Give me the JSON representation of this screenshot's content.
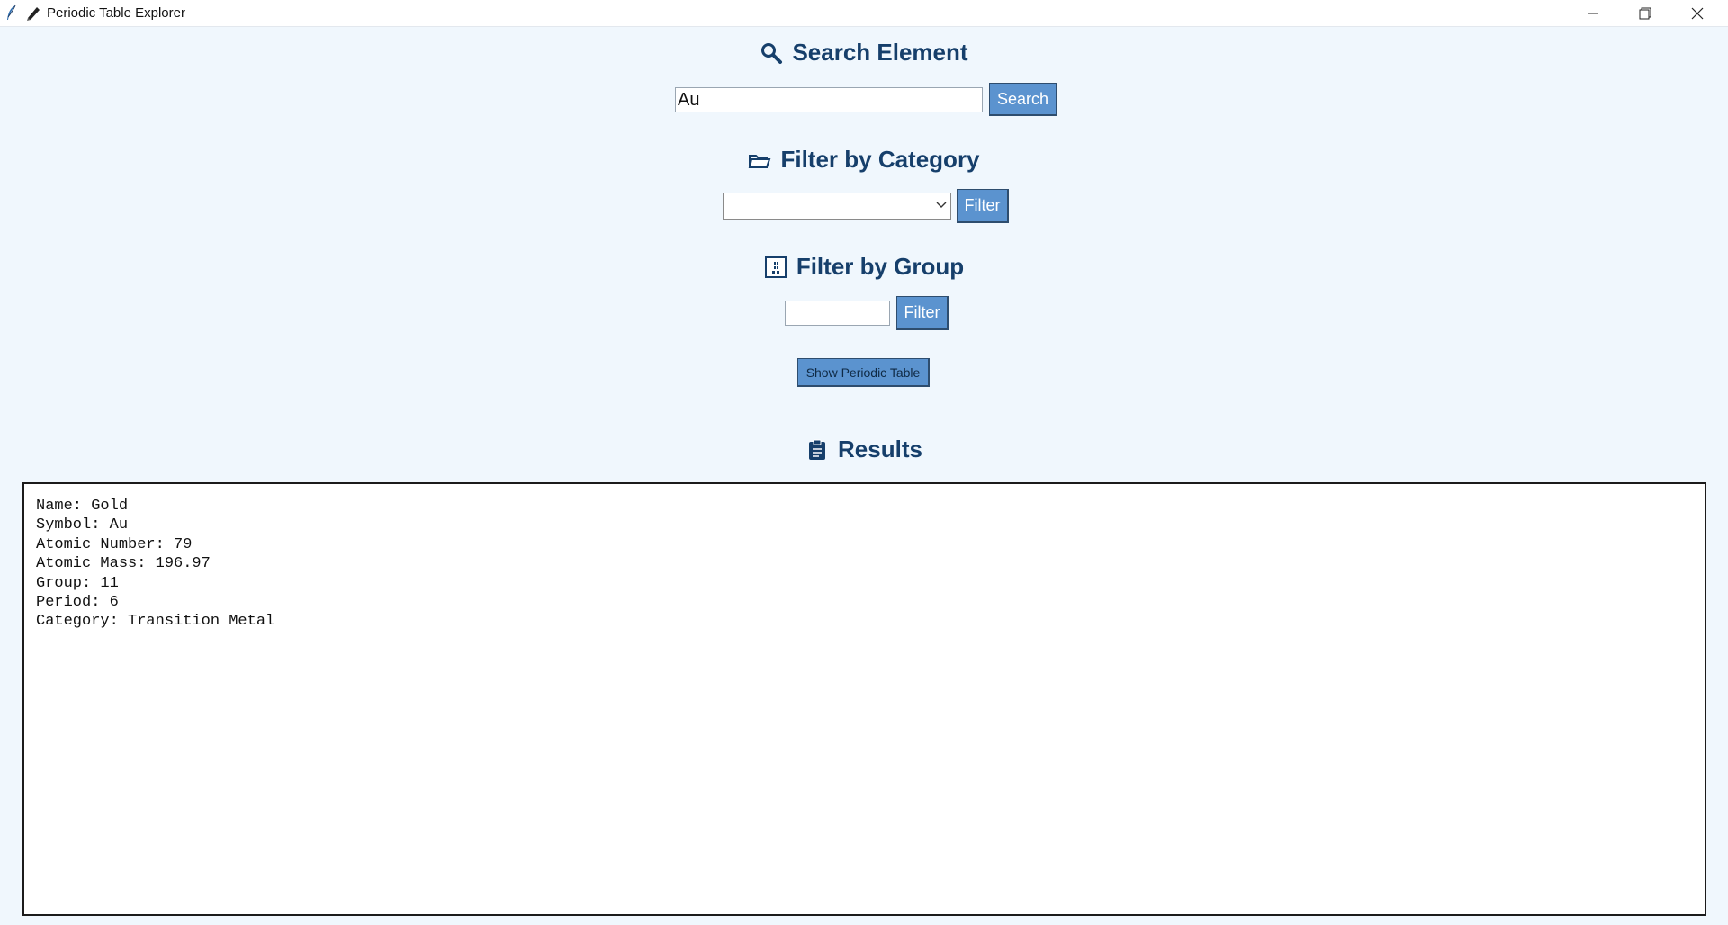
{
  "window": {
    "title": "Periodic Table Explorer",
    "icons": [
      "feather-icon",
      "pen-icon"
    ]
  },
  "search": {
    "title": "Search Element",
    "icon": "magnifier-icon",
    "value": "Au",
    "button_label": "Search"
  },
  "category_filter": {
    "title": "Filter by Category",
    "icon": "folder-icon",
    "selected": "",
    "button_label": "Filter"
  },
  "group_filter": {
    "title": "Filter by Group",
    "icon": "grid-icon",
    "value": "",
    "button_label": "Filter"
  },
  "show_table_button": "Show Periodic Table",
  "results": {
    "title": "Results",
    "icon": "clipboard-icon",
    "lines": [
      "Name: Gold",
      "Symbol: Au",
      "Atomic Number: 79",
      "Atomic Mass: 196.97",
      "Group: 11",
      "Period: 6",
      "Category: Transition Metal"
    ]
  },
  "colors": {
    "background": "#f0f7fd",
    "heading": "#163f6b",
    "button": "#5b93cf"
  }
}
